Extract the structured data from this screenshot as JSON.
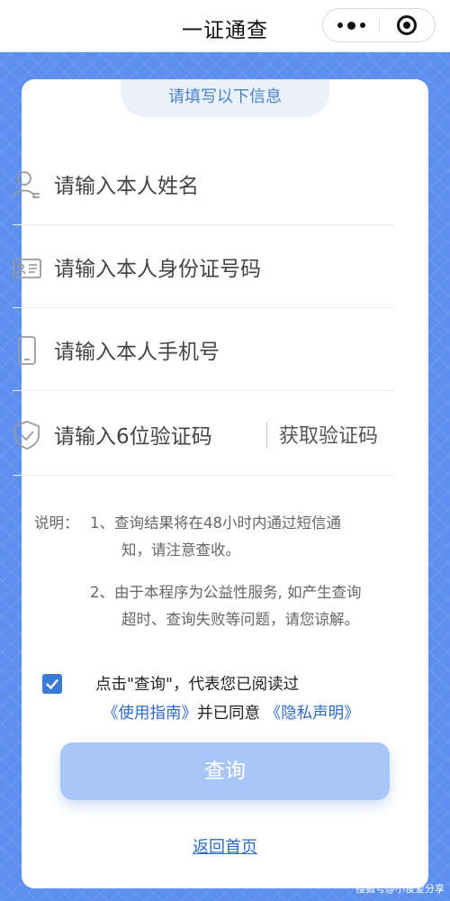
{
  "app": {
    "title": "一证通查"
  },
  "form": {
    "header": "请填写以下信息",
    "name_placeholder": "请输入本人姓名",
    "id_placeholder": "请输入本人身份证号码",
    "phone_placeholder": "请输入本人手机号",
    "code_placeholder": "请输入6位验证码",
    "get_code_label": "获取验证码"
  },
  "notes": {
    "label": "说明：",
    "item1_line1": "1、查询结果将在48小时内通过短信通",
    "item1_line2": "知，请注意查收。",
    "item2_line1": "2、由于本程序为公益性服务, 如产生查询",
    "item2_line2": "超时、查询失败等问题，请您谅解。"
  },
  "agreement": {
    "checked": true,
    "line1": "点击\"查询\"，代表您已阅读过",
    "guide_link": "《使用指南》",
    "and_text": "并已同意",
    "privacy_link": "《隐私声明》"
  },
  "actions": {
    "query_label": "查询",
    "back_label": "返回首页"
  },
  "watermark": "搜狐号@小俊爱分享",
  "colors": {
    "accent_blue": "#5d8ff0",
    "link_blue": "#2f6bc6",
    "button_disabled": "#a8c6f7"
  }
}
